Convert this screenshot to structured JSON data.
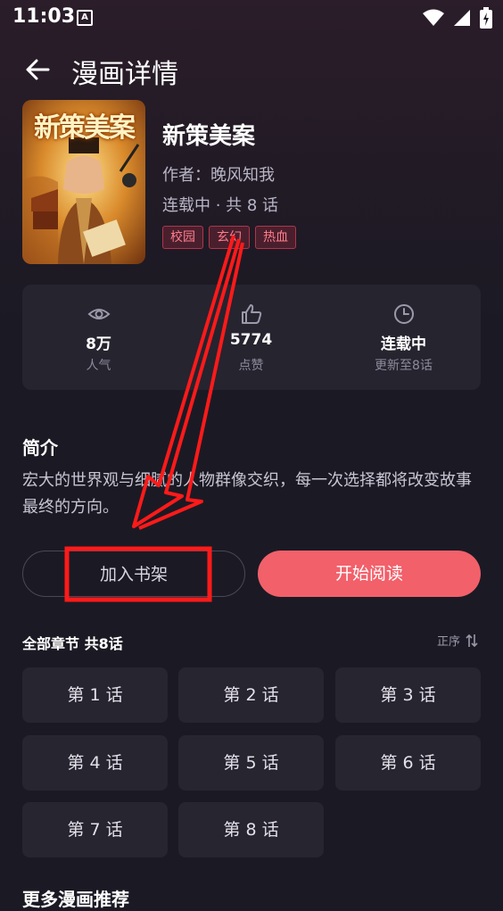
{
  "status_bar": {
    "time": "11:03",
    "indicator": "A"
  },
  "header": {
    "title": "漫画详情"
  },
  "comic": {
    "cover_title": "新策美案",
    "name": "新策美案",
    "author": "作者：晚风知我",
    "status": "连载中 · 共 8 话",
    "tags": [
      "校园",
      "玄幻",
      "热血"
    ]
  },
  "stats": [
    {
      "icon": "eye-icon",
      "value": "8万",
      "label": "人气"
    },
    {
      "icon": "thumbs-up-icon",
      "value": "5774",
      "label": "点赞"
    },
    {
      "icon": "clock-icon",
      "value": "连载中",
      "label": "更新至8话"
    }
  ],
  "intro": {
    "heading": "简介",
    "text": "宏大的世界观与细腻的人物群像交织，每一次选择都将改变故事最终的方向。"
  },
  "actions": {
    "shelf_label": "加入书架",
    "read_label": "开始阅读"
  },
  "chapters": {
    "heading": "全部章节  共8话",
    "sort_label": "正序",
    "items": [
      "第 1 话",
      "第 2 话",
      "第 3 话",
      "第 4 话",
      "第 5 话",
      "第 6 话",
      "第 7 话",
      "第 8 话"
    ]
  },
  "more": {
    "heading": "更多漫画推荐"
  },
  "colors": {
    "accent": "#f2606a",
    "tag": "#ff7d8c",
    "annotation": "#ff0000"
  }
}
